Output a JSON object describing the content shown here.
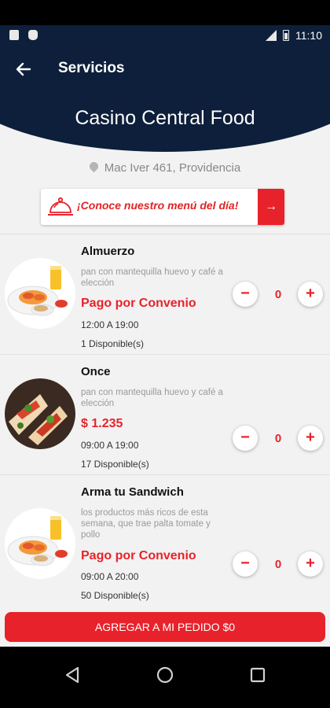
{
  "status_bar": {
    "time": "11:10"
  },
  "app_bar": {
    "title": "Servicios"
  },
  "venue": {
    "name": "Casino Central Food",
    "address": "Mac Iver 461, Providencia"
  },
  "menu_banner": {
    "label": "¡Conoce nuestro menú del día!",
    "arrow": "→"
  },
  "stepper": {
    "minus": "−",
    "plus": "+"
  },
  "items": [
    {
      "name": "Almuerzo",
      "description": "pan con mantequilla huevo y café a elección",
      "price": "Pago por Convenio",
      "hours": "12:00 A 19:00",
      "availability": "1 Disponible(s)",
      "quantity": "0"
    },
    {
      "name": "Once",
      "description": "pan con mantequilla huevo y café a elección",
      "price": "$ 1.235",
      "hours": "09:00 A 19:00",
      "availability": "17 Disponible(s)",
      "quantity": "0"
    },
    {
      "name": "Arma tu Sandwich",
      "description": "los productos más ricos de esta semana, que trae palta tomate y pollo",
      "price": "Pago por Convenio",
      "hours": "09:00 A 20:00",
      "availability": "50 Disponible(s)",
      "quantity": "0"
    }
  ],
  "footer": {
    "add_order_label": "AGREGAR A MI PEDIDO $0"
  },
  "colors": {
    "primary_navy": "#0d1f3a",
    "accent_red": "#e8222b"
  }
}
